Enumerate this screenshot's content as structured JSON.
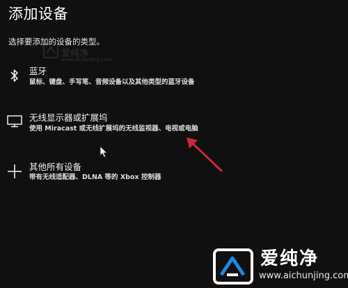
{
  "dialog": {
    "title": "添加设备",
    "subtitle": "选择要添加的设备的类型。"
  },
  "options": [
    {
      "label": "蓝牙",
      "description": "鼠标、键盘、手写笔、音频设备以及其他类型的蓝牙设备",
      "icon": "bluetooth-icon"
    },
    {
      "label": "无线显示器或扩展坞",
      "description": "使用 Miracast 或无线扩展坞的无线监视器、电视或电脑",
      "icon": "monitor-icon"
    },
    {
      "label": "其他所有设备",
      "description": "带有无线适配器、DLNA 等的 Xbox 控制器",
      "icon": "plus-icon"
    }
  ],
  "annotation": {
    "arrow_color": "#c8283a",
    "arrow_icon": "red-arrow-icon"
  },
  "watermark": {
    "small_text": "爱纯净",
    "small_url": "www.aichunjing.com",
    "brand_text": "爱纯净",
    "url": "www.aichunjing.com",
    "logo_icon": "aichunjing-logo-icon"
  },
  "colors": {
    "background": "#101010",
    "text": "#ffffff",
    "accent_arrow": "#c8283a"
  }
}
